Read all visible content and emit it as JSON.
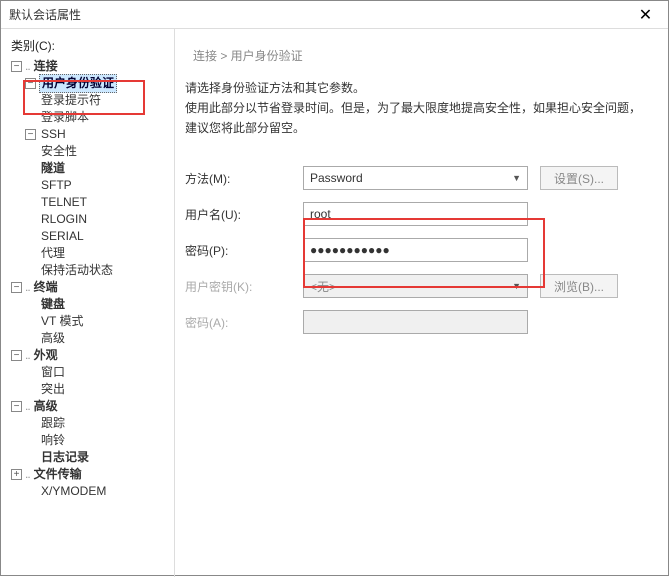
{
  "window": {
    "title": "默认会话属性"
  },
  "sidebar": {
    "label": "类别(C):",
    "tree": {
      "connection": "连接",
      "auth": "用户身份验证",
      "login_prompt": "登录提示符",
      "login_script": "登录脚本",
      "ssh": "SSH",
      "security": "安全性",
      "tunnel": "隧道",
      "sftp": "SFTP",
      "telnet": "TELNET",
      "rlogin": "RLOGIN",
      "serial": "SERIAL",
      "proxy": "代理",
      "keep_alive": "保持活动状态",
      "terminal": "终端",
      "keyboard": "键盘",
      "vt": "VT 模式",
      "advanced1": "高级",
      "appearance": "外观",
      "window": "窗口",
      "highlight": "突出",
      "advanced2": "高级",
      "trace": "跟踪",
      "bell": "响铃",
      "logging": "日志记录",
      "file_transfer": "文件传输",
      "xymodem": "X/YMODEM"
    }
  },
  "main": {
    "breadcrumb": "连接 > 用户身份验证",
    "desc1": "请选择身份验证方法和其它参数。",
    "desc2": "使用此部分以节省登录时间。但是，为了最大限度地提高安全性，如果担心安全问题，建议您将此部分留空。",
    "method_label": "方法(M):",
    "method_value": "Password",
    "set_btn": "设置(S)...",
    "user_label": "用户名(U):",
    "user_value": "root",
    "pass_label": "密码(P):",
    "pass_value": "●●●●●●●●●●●",
    "userkey_label": "用户密钥(K):",
    "userkey_value": "<无>",
    "browse_btn": "浏览(B)...",
    "pass2_label": "密码(A):"
  }
}
